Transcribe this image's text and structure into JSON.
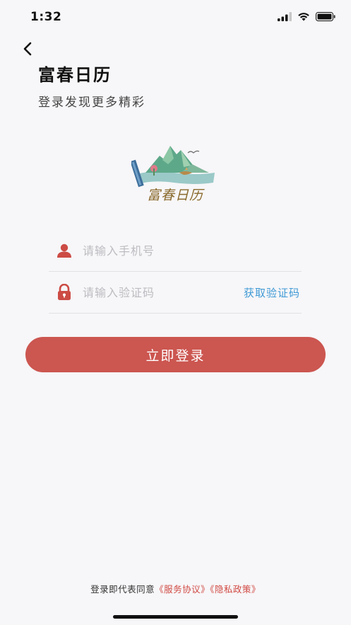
{
  "status_bar": {
    "time": "1:32"
  },
  "header": {
    "title": "富春日历",
    "subtitle": "登录发现更多精彩"
  },
  "logo": {
    "text": "富春日历"
  },
  "form": {
    "phone": {
      "placeholder": "请输入手机号",
      "value": "",
      "icon": "user-icon"
    },
    "code": {
      "placeholder": "请输入验证码",
      "value": "",
      "icon": "lock-icon",
      "get_code_label": "获取验证码"
    },
    "login_label": "立即登录"
  },
  "agreement": {
    "prefix": "登录即代表同意",
    "service_link": "《服务协议》",
    "privacy_link": "《隐私政策》"
  },
  "colors": {
    "accent": "#cc5650",
    "link_blue": "#3f9ad6",
    "link_red": "#d14a44",
    "background": "#f7f6f8"
  }
}
